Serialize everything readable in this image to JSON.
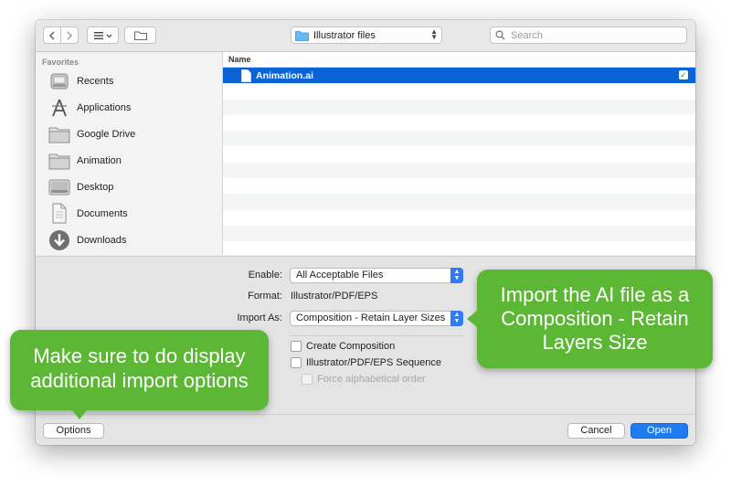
{
  "toolbar": {
    "back_icon": "chevron-left-icon",
    "forward_icon": "chevron-right-icon",
    "view_icon": "list-view-icon",
    "new_folder_icon": "new-folder-icon",
    "location": "Illustrator files",
    "search_placeholder": "Search"
  },
  "sidebar": {
    "heading": "Favorites",
    "items": [
      {
        "label": "Recents",
        "icon": "recents-icon"
      },
      {
        "label": "Applications",
        "icon": "applications-icon"
      },
      {
        "label": "Google Drive",
        "icon": "folder-icon"
      },
      {
        "label": "Animation",
        "icon": "folder-icon"
      },
      {
        "label": "Desktop",
        "icon": "desktop-icon"
      },
      {
        "label": "Documents",
        "icon": "documents-icon"
      },
      {
        "label": "Downloads",
        "icon": "downloads-icon"
      }
    ]
  },
  "file_list": {
    "column_header": "Name",
    "files": [
      {
        "name": "Animation.ai",
        "selected": true
      }
    ]
  },
  "options": {
    "enable_label": "Enable:",
    "enable_value": "All Acceptable Files",
    "format_label": "Format:",
    "format_value": "Illustrator/PDF/EPS",
    "import_as_label": "Import As:",
    "import_as_value": "Composition - Retain Layer Sizes",
    "create_composition": "Create Composition",
    "sequence": "Illustrator/PDF/EPS Sequence",
    "force_alpha": "Force alphabetical order"
  },
  "buttons": {
    "options": "Options",
    "cancel": "Cancel",
    "open": "Open"
  },
  "callouts": {
    "right": [
      "Import the AI file as a",
      "Composition - Retain",
      "Layers Size"
    ],
    "left": [
      "Make sure to do display",
      "additional import options"
    ]
  },
  "colors": {
    "selection": "#0a64d6",
    "accent": "#1f7cf0",
    "callout": "#5bb734"
  }
}
